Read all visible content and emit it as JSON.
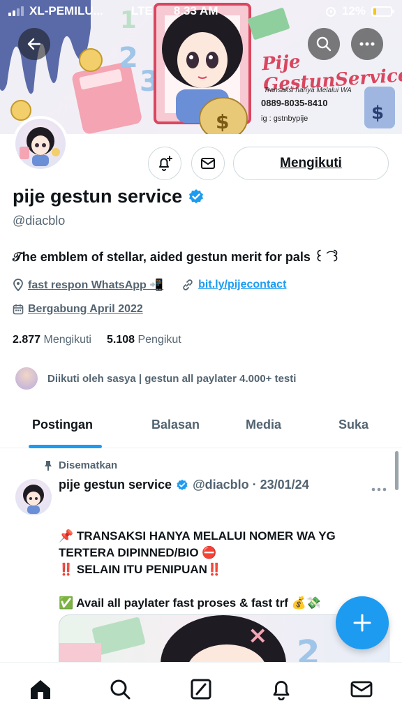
{
  "status_bar": {
    "carrier": "XL-PEMILU...",
    "network": "LTE",
    "time": "8.33 AM",
    "battery": "12%"
  },
  "banner": {
    "title": "Pije GestunService",
    "note": "Transaksi hanya Melalui WA",
    "phone": "0889-8035-8410",
    "instagram": "ig : gstnbypije"
  },
  "profile": {
    "name": "pije gestun service",
    "handle": "@diacblo",
    "bio": "𝒯he emblem of stellar, aided gestun merit for pals ꒰ ͡ ꒱",
    "location": "fast respon WhatsApp 📲",
    "link": "bit.ly/pijecontact",
    "joined": "Bergabung April 2022",
    "following_count": "2.877",
    "following_label": "Mengikuti",
    "followers_count": "5.108",
    "followers_label": "Pengikut",
    "followed_by": "Diikuti oleh sasya | gestun all paylater 4.000+ testi",
    "follow_button": "Mengikuti"
  },
  "tabs": [
    {
      "label": "Postingan"
    },
    {
      "label": "Balasan"
    },
    {
      "label": "Media"
    },
    {
      "label": "Suka"
    }
  ],
  "post": {
    "pinned_label": "Disematkan",
    "author": "pije gestun service",
    "meta": "@diacblo · 23/01/24",
    "line1": "📌 TRANSAKSI HANYA MELALUI NOMER WA YG",
    "line2": "TERTERA DIPINNED/BIO ⛔",
    "line3": "‼️ SELAIN ITU PENIPUAN‼️",
    "line4": "✅ Avail all paylater fast proses & fast trf 💰💸"
  },
  "colors": {
    "accent": "#1d9bf0",
    "text": "#0f1419",
    "muted": "#536471",
    "banner_title": "#d9465f"
  },
  "icons": [
    "back-arrow-icon",
    "search-icon",
    "more-icon",
    "notification-bell-plus-icon",
    "envelope-icon",
    "verified-badge-icon",
    "location-pin-icon",
    "link-icon",
    "calendar-icon",
    "pin-icon",
    "plus-icon",
    "home-icon",
    "compose-icon",
    "bell-icon"
  ]
}
